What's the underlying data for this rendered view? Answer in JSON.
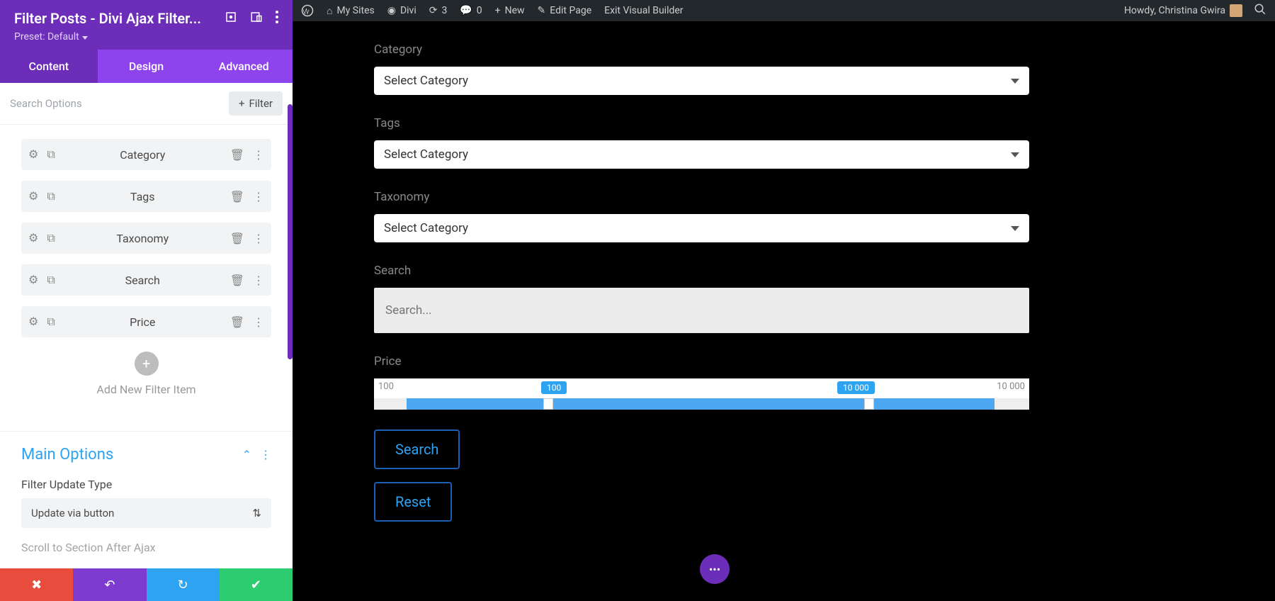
{
  "sidebar": {
    "title": "Filter Posts - Divi Ajax Filter...",
    "preset": "Preset: Default",
    "tabs": [
      "Content",
      "Design",
      "Advanced"
    ],
    "search_options_label": "Search Options",
    "add_filter_label": "Filter",
    "items": [
      {
        "label": "Category"
      },
      {
        "label": "Tags"
      },
      {
        "label": "Taxonomy"
      },
      {
        "label": "Search"
      },
      {
        "label": "Price"
      }
    ],
    "add_new_filter_label": "Add New Filter Item",
    "main_options": {
      "title": "Main Options",
      "filter_update_type_label": "Filter Update Type",
      "filter_update_type_value": "Update via button",
      "scroll_label": "Scroll to Section After Ajax"
    }
  },
  "adminbar": {
    "my_sites": "My Sites",
    "divi": "Divi",
    "refresh_count": "3",
    "comments_count": "0",
    "new": "New",
    "edit_page": "Edit Page",
    "exit_vb": "Exit Visual Builder",
    "howdy": "Howdy, Christina Gwira"
  },
  "preview": {
    "category_label": "Category",
    "category_value": "Select Category",
    "tags_label": "Tags",
    "tags_value": "Select Category",
    "taxonomy_label": "Taxonomy",
    "taxonomy_value": "Select Category",
    "search_label": "Search",
    "search_placeholder": "Search...",
    "price_label": "Price",
    "price_min": "100",
    "price_max": "10 000",
    "price_val_low": "100",
    "price_val_high": "10 000",
    "search_btn": "Search",
    "reset_btn": "Reset"
  }
}
